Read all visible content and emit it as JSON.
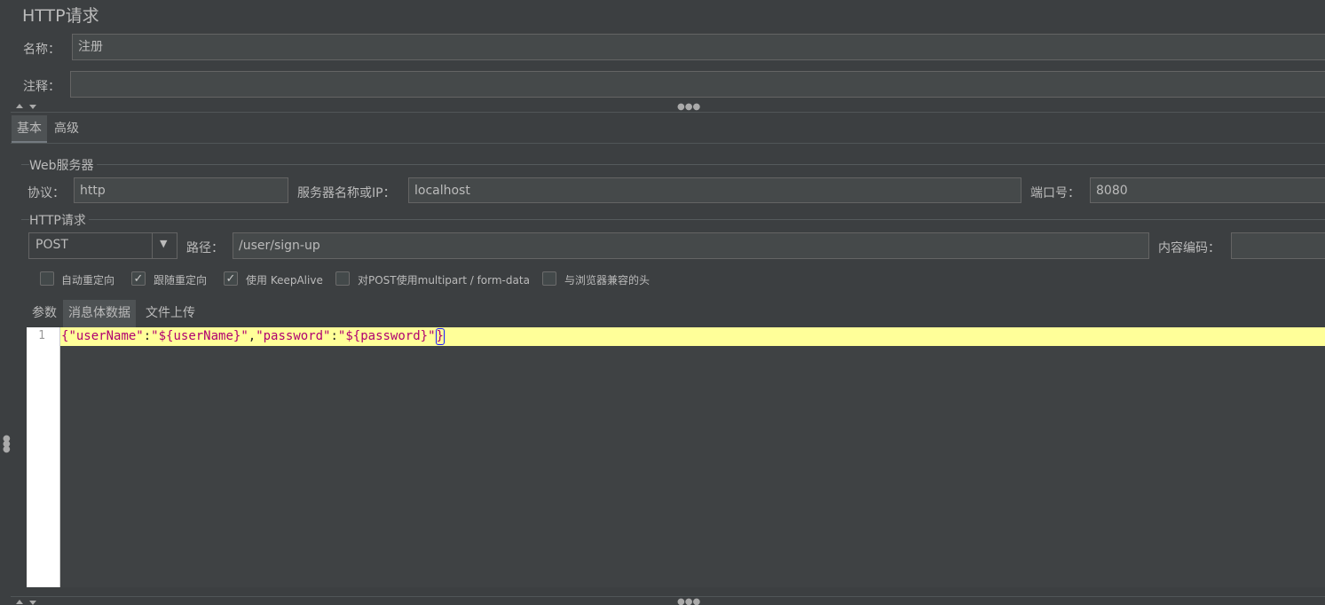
{
  "window": {
    "title": "HTTP请求"
  },
  "form": {
    "name_label": "名称：",
    "name_value": "注册",
    "comment_label": "注释：",
    "comment_value": ""
  },
  "tabs": [
    {
      "label": "基本",
      "active": true
    },
    {
      "label": "高级",
      "active": false
    }
  ],
  "web_server": {
    "group_title": "Web服务器",
    "protocol_label": "协议：",
    "protocol_value": "http",
    "server_label": "服务器名称或IP：",
    "server_value": "localhost",
    "port_label": "端口号：",
    "port_value": "8080"
  },
  "http_request": {
    "group_title": "HTTP请求",
    "method_value": "POST",
    "path_label": "路径：",
    "path_value": "/user/sign-up",
    "encoding_label": "内容编码：",
    "encoding_value": ""
  },
  "options": [
    {
      "label": "自动重定向",
      "checked": false
    },
    {
      "label": "跟随重定向",
      "checked": true
    },
    {
      "label": "使用 KeepAlive",
      "checked": true
    },
    {
      "label": "对POST使用multipart / form-data",
      "checked": false
    },
    {
      "label": "与浏览器兼容的头",
      "checked": false
    }
  ],
  "subtabs": [
    {
      "label": "参数",
      "active": false
    },
    {
      "label": "消息体数据",
      "active": true
    },
    {
      "label": "文件上传",
      "active": false
    }
  ],
  "editor": {
    "line_number": "1",
    "tokens": {
      "open_brace": "{",
      "key1": "\"userName\"",
      "colon1": ":",
      "val1": "\"${userName}\"",
      "comma": ",",
      "key2": "\"password\"",
      "colon2": ":",
      "val2": "\"${password}\"",
      "close_brace": "}"
    }
  },
  "icons": {
    "check": "✓",
    "chevron": "▼"
  }
}
